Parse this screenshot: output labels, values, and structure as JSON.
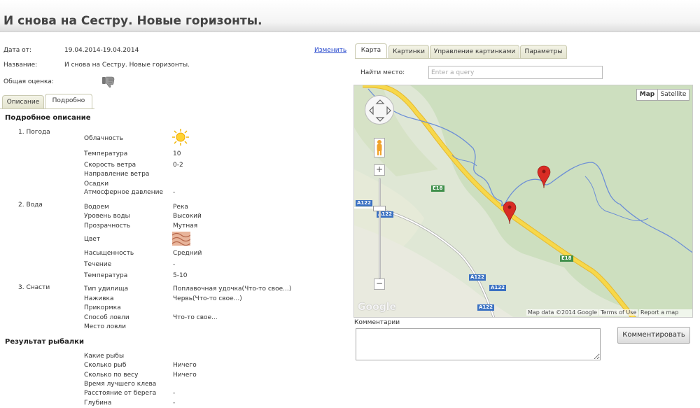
{
  "page": {
    "title": "И снова на Сестру. Новые горизонты."
  },
  "info": {
    "date_label": "Дата от:",
    "date_value": "19.04.2014-19.04.2014",
    "change_link": "Изменить",
    "name_label": "Название:",
    "name_value": "И снова на Сестру. Новые горизонты.",
    "rating_label": "Общая оценка:"
  },
  "left_tabs": [
    "Описание",
    "Подробно"
  ],
  "detail": {
    "title": "Подробное описание",
    "groups": [
      {
        "label": "1. Погода",
        "rows": [
          {
            "label": "Облачность",
            "value": "",
            "icon": "sun-icon"
          },
          {
            "label": "Температура",
            "value": "10"
          },
          {
            "label": "Скорость ветра",
            "value": "0-2"
          },
          {
            "label": "Направление ветра",
            "value": ""
          },
          {
            "label": "Осадки",
            "value": ""
          },
          {
            "label": "Атмосферное давление",
            "value": "-"
          }
        ]
      },
      {
        "label": "2. Вода",
        "rows": [
          {
            "label": "Водоем",
            "value": "Река"
          },
          {
            "label": "Уровень воды",
            "value": "Высокий"
          },
          {
            "label": "Прозрачность",
            "value": "Мутная"
          },
          {
            "label": "Цвет",
            "value": "",
            "icon": "water-color-icon"
          },
          {
            "label": "Насыщенность",
            "value": "Средний"
          },
          {
            "label": "Течение",
            "value": "-"
          },
          {
            "label": "Температура",
            "value": "5-10"
          }
        ]
      },
      {
        "label": "3. Снасти",
        "rows": [
          {
            "label": "Тип удилища",
            "value": "Поплавочная удочка(Что-то свое...)"
          },
          {
            "label": "Наживка",
            "value": "Червь(Что-то свое...)"
          },
          {
            "label": "Прикормка",
            "value": ""
          },
          {
            "label": "Способ ловли",
            "value": "Что-то свое..."
          },
          {
            "label": "Место ловли",
            "value": ""
          }
        ]
      }
    ]
  },
  "result": {
    "title": "Результат рыбалки",
    "rows": [
      {
        "label": "Какие рыбы",
        "value": ""
      },
      {
        "label": "Сколько рыб",
        "value": "Ничего"
      },
      {
        "label": "Сколько по весу",
        "value": "Ничего"
      },
      {
        "label": "Время лучшего клева",
        "value": ""
      },
      {
        "label": "Расстояние от берега",
        "value": "-"
      },
      {
        "label": "Глубина",
        "value": "-"
      }
    ]
  },
  "right_tabs": [
    "Карта",
    "Картинки",
    "Управление картинками",
    "Параметры"
  ],
  "search": {
    "label": "Найти место:",
    "placeholder": "Enter a query"
  },
  "map": {
    "type_map": "Map",
    "type_satellite": "Satellite",
    "road_labels": {
      "e18a": "E18",
      "e18b": "E18",
      "a122a": "A122",
      "a122b": "A122",
      "a122c": "A122",
      "a122d": "A122",
      "a122e": "A122"
    },
    "logo": "Google",
    "attrib_data": "Map data ©2014 Google",
    "attrib_terms": "Terms of Use",
    "attrib_report": "Report a map error",
    "colors": {
      "land": "#dfe7d5",
      "forest": "#c8dbb8",
      "highway": "#f2cf3a",
      "river": "#6d8fd6",
      "marker": "#d92c25"
    }
  },
  "comments": {
    "label": "Комментарии",
    "button": "Комментировать"
  }
}
